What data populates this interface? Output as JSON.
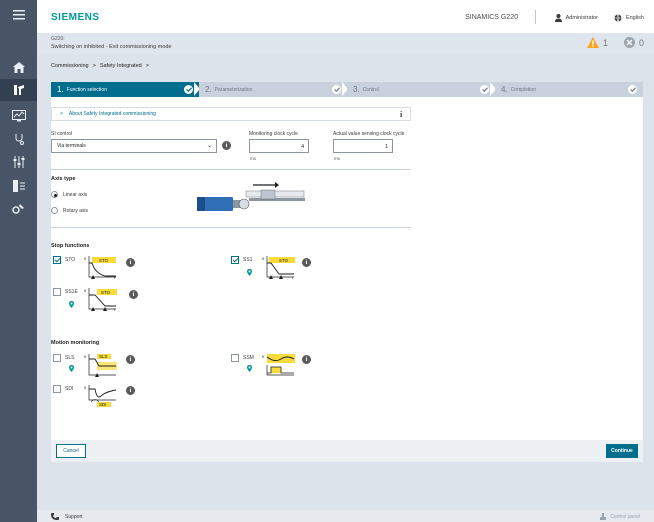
{
  "header": {
    "brand": "SIEMENS",
    "device": "SINAMICS G220",
    "user": "Administrator",
    "language": "English"
  },
  "status": {
    "device": "G220:",
    "message": "Switching on inhibited - Exit commissioning mode",
    "warnings": "1",
    "errors": "0"
  },
  "breadcrumb": {
    "items": [
      "Commissioning",
      "Safety Integrated"
    ],
    "separator": ">"
  },
  "steps": [
    {
      "num": "1.",
      "label": "Function selection"
    },
    {
      "num": "2.",
      "label": "Parameterization"
    },
    {
      "num": "3.",
      "label": "Control"
    },
    {
      "num": "4.",
      "label": "Completion"
    }
  ],
  "about": {
    "label": "About Safety Integrated commissioning",
    "info": "i"
  },
  "si_control": {
    "label": "SI control",
    "value": "Via terminals"
  },
  "monitoring_clock": {
    "label": "Monitoring clock cycle",
    "value": "4",
    "unit": "ms"
  },
  "actual_value_clock": {
    "label": "Actual value sensing clock cycle",
    "value": "1",
    "unit": "ms"
  },
  "axis_type": {
    "title": "Axis type",
    "options": [
      "Linear axis",
      "Rotary axis"
    ],
    "selected": "Linear axis"
  },
  "stop_functions": {
    "title": "Stop functions",
    "items": [
      {
        "name": "STO",
        "checked": true,
        "tag": "STO"
      },
      {
        "name": "SS1",
        "checked": true,
        "tag": "STO"
      },
      {
        "name": "SS1E",
        "checked": false,
        "tag": "STO"
      }
    ]
  },
  "motion_monitoring": {
    "title": "Motion monitoring",
    "items": [
      {
        "name": "SLS",
        "checked": false,
        "tag": "SLS"
      },
      {
        "name": "SSM",
        "checked": false,
        "tag": ""
      },
      {
        "name": "SDI",
        "checked": false,
        "tag": "SDI"
      }
    ]
  },
  "diagram_axes": {
    "v": "v",
    "t": "t"
  },
  "actions": {
    "cancel": "Cancel",
    "continue": "Continue"
  },
  "footer": {
    "support": "Support",
    "control_panel": "Control panel"
  },
  "colors": {
    "brand": "#009999",
    "accent": "#006e8c",
    "sidebar": "#475566",
    "warning": "#f5a623",
    "highlight": "#f7dc3c"
  }
}
